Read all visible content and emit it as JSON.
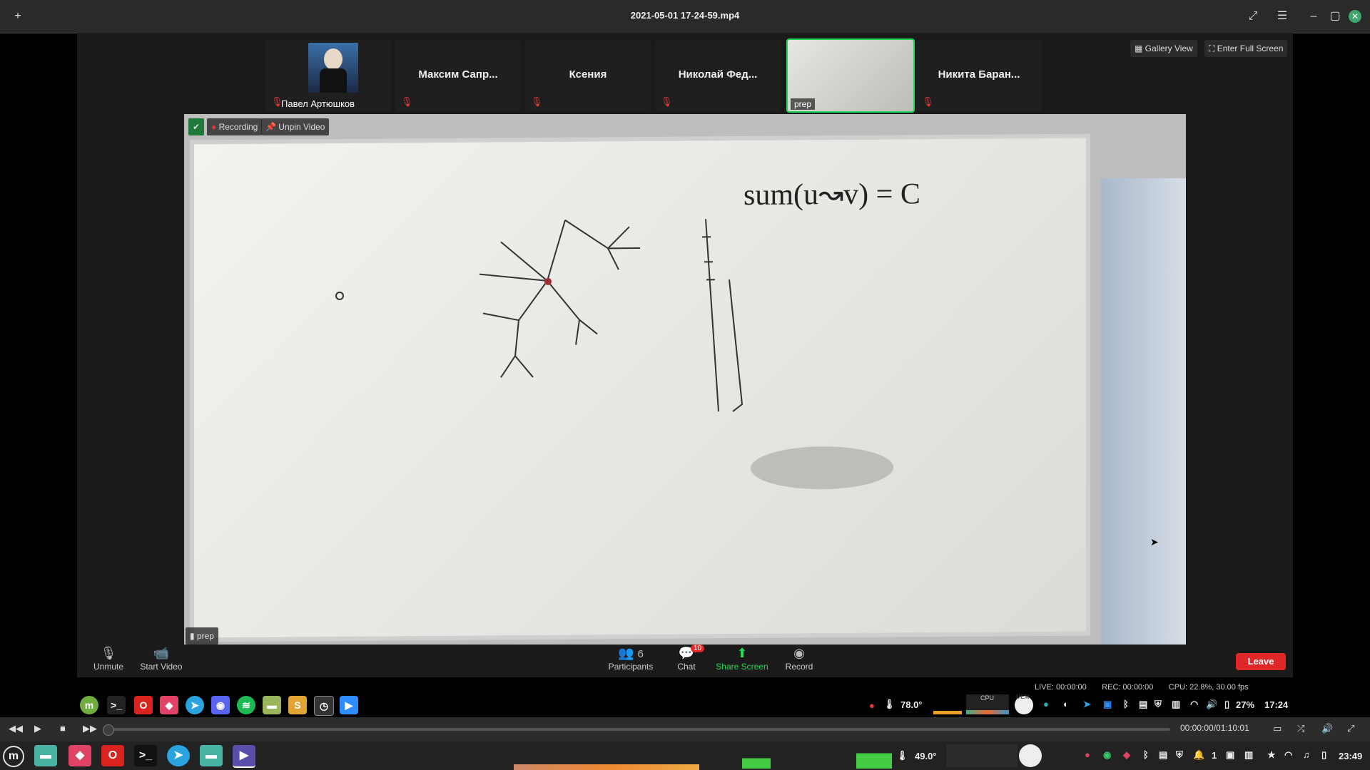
{
  "window": {
    "title": "2021-05-01 17-24-59.mp4"
  },
  "zoom": {
    "participants_strip": [
      {
        "name": "Павел Артюшков",
        "has_avatar": true,
        "muted": true
      },
      {
        "name": "Максим Сапр...",
        "muted": true
      },
      {
        "name": "Ксения",
        "muted": true
      },
      {
        "name": "Николай Фед...",
        "muted": true
      },
      {
        "name": "prep",
        "has_video": true,
        "active": true
      },
      {
        "name": "Никита Баран...",
        "muted": true
      }
    ],
    "gallery_view_label": "Gallery View",
    "full_screen_label": "Enter Full Screen",
    "recording_label": "Recording",
    "unpin_label": "Unpin Video",
    "speaker_label": "prep",
    "whiteboard_text": "sum(u↝v) = C",
    "controls": {
      "unmute": "Unmute",
      "start_video": "Start Video",
      "participants": "Participants",
      "participants_count": "6",
      "chat": "Chat",
      "chat_badge": "10",
      "share_screen": "Share Screen",
      "record": "Record",
      "leave": "Leave"
    },
    "accent_green": "#23d959",
    "leave_color": "#e02828"
  },
  "status": {
    "live": "LIVE: 00:00:00",
    "rec": "REC: 00:00:00",
    "cpu": "CPU: 22.8%, 30.00 fps"
  },
  "inner_taskbar": {
    "temp": "78.0°",
    "battery": "27%",
    "time": "17:24",
    "cpu_label": "CPU",
    "mem_label": "MEM"
  },
  "player": {
    "time": "00:00:00/01:10:01",
    "progress": 0
  },
  "system_taskbar": {
    "temp": "49.0°",
    "time": "23:49",
    "workspace": "1"
  }
}
